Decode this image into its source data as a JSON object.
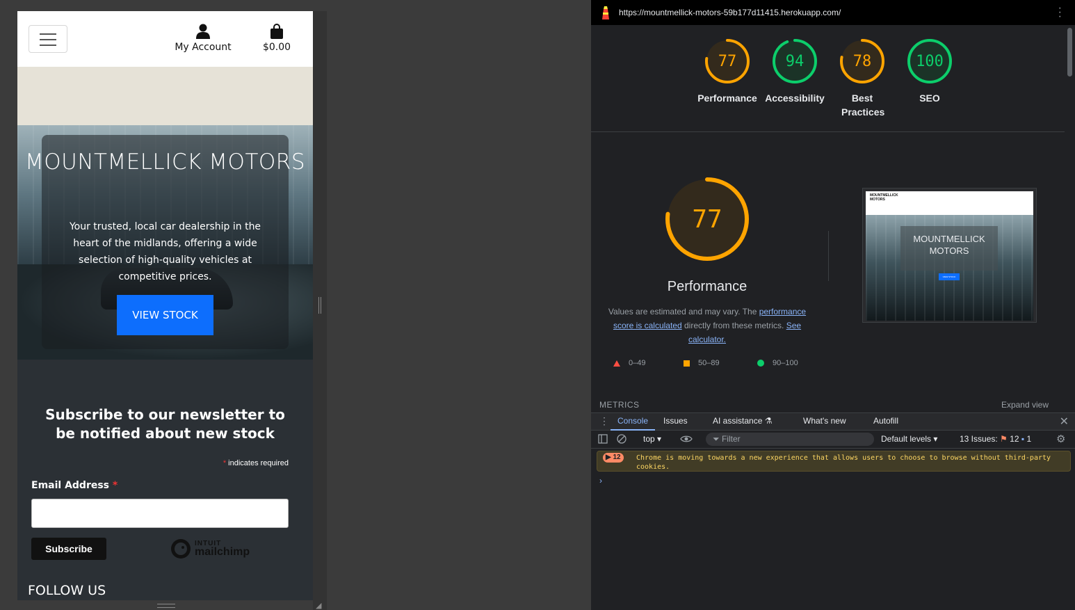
{
  "mobile": {
    "nav": {
      "account_label": "My Account",
      "bag_total": "$0.00"
    },
    "hero": {
      "title": "MOUNTMELLICK MOTORS",
      "subtitle": "Your trusted, local car dealership in the heart of the midlands, offering a wide selection of high-quality vehicles at competitive prices.",
      "cta": "VIEW STOCK"
    },
    "newsletter": {
      "heading": "Subscribe to our newsletter to be notified about new stock",
      "required_mark": "*",
      "required_note": " indicates required",
      "email_label": "Email Address",
      "email_value": "",
      "subscribe_label": "Subscribe",
      "brand_top": "INTUIT",
      "brand_name": "mailchimp"
    },
    "follow_heading": "FOLLOW US"
  },
  "devtools": {
    "url": "https://mountmellick-motors-59b177d11415.herokuapp.com/",
    "scores": [
      {
        "label": "Performance",
        "value": 77,
        "color": "#ffa400"
      },
      {
        "label": "Accessibility",
        "value": 94,
        "color": "#0cce6b"
      },
      {
        "label": "Best Practices",
        "value": 78,
        "color": "#ffa400"
      },
      {
        "label": "SEO",
        "value": 100,
        "color": "#0cce6b"
      }
    ],
    "main": {
      "score": 77,
      "title": "Performance",
      "desc_pre": "Values are estimated and may vary. The ",
      "desc_link1": "performance score is calculated",
      "desc_mid": " directly from these metrics. ",
      "desc_link2": "See calculator.",
      "legend": [
        "0–49",
        "50–89",
        "90–100"
      ]
    },
    "thumbnail": {
      "brand": "MOUNTMELLICK MOTORS",
      "title": "MOUNTMELLICK MOTORS",
      "cta": "VIEW STOCK"
    },
    "metrics_label": "METRICS",
    "expand_label": "Expand view",
    "tabs": [
      "Console",
      "Issues",
      "AI assistance",
      "What's new",
      "Autofill"
    ],
    "console": {
      "context": "top",
      "filter_placeholder": "Filter",
      "levels": "Default levels",
      "issues_label": "13 Issues:",
      "issues_warn": "12",
      "issues_info": "1",
      "message_count": "12",
      "message": "Chrome is moving towards a new experience that allows users to choose to browse without third-party cookies.",
      "prompt": "›"
    }
  }
}
